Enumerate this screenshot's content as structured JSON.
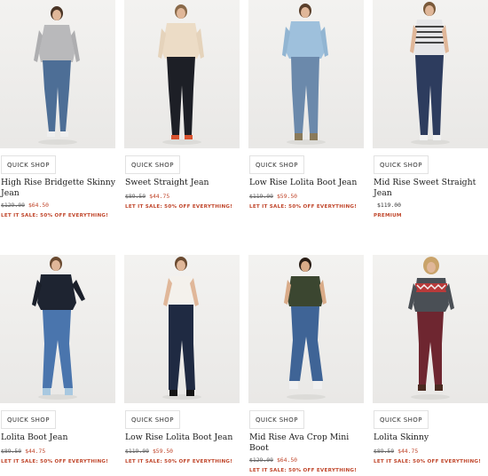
{
  "products": [
    {
      "name": "High Rise Bridgette Skinny Jean",
      "original_price": "$129.00",
      "price": "$64.50",
      "promo": "LET IT SALE: 50% OFF EVERYTHING!",
      "quick_shop": "QUICK SHOP"
    },
    {
      "name": "Sweet Straight Jean",
      "original_price": "$89.50",
      "price": "$44.75",
      "promo": "LET IT SALE: 50% OFF EVERYTHING!",
      "quick_shop": "QUICK SHOP"
    },
    {
      "name": "Low Rise Lolita Boot Jean",
      "original_price": "$119.00",
      "price": "$59.50",
      "promo": "LET IT SALE: 50% OFF EVERYTHING!",
      "quick_shop": "QUICK SHOP"
    },
    {
      "name": "Mid Rise Sweet Straight Jean",
      "original_price": "",
      "price": "$119.00",
      "promo": "PREMIUM",
      "quick_shop": "QUICK SHOP"
    },
    {
      "name": "Lolita Boot Jean",
      "original_price": "$89.50",
      "price": "$44.75",
      "promo": "LET IT SALE: 50% OFF EVERYTHING!",
      "quick_shop": "QUICK SHOP"
    },
    {
      "name": "Low Rise Lolita Boot Jean",
      "original_price": "$119.00",
      "price": "$59.50",
      "promo": "LET IT SALE: 50% OFF EVERYTHING!",
      "quick_shop": "QUICK SHOP"
    },
    {
      "name": "Mid Rise Ava Crop Mini Boot",
      "original_price": "$129.00",
      "price": "$64.50",
      "promo": "LET IT SALE: 50% OFF EVERYTHING!",
      "quick_shop": "QUICK SHOP"
    },
    {
      "name": "Lolita Skinny",
      "original_price": "$89.50",
      "price": "$44.75",
      "promo": "LET IT SALE: 50% OFF EVERYTHING!",
      "quick_shop": "QUICK SHOP"
    }
  ],
  "colors": {
    "sale": "#c0462b",
    "text": "#1c1c1c",
    "photo_bg": "#efeeec"
  }
}
